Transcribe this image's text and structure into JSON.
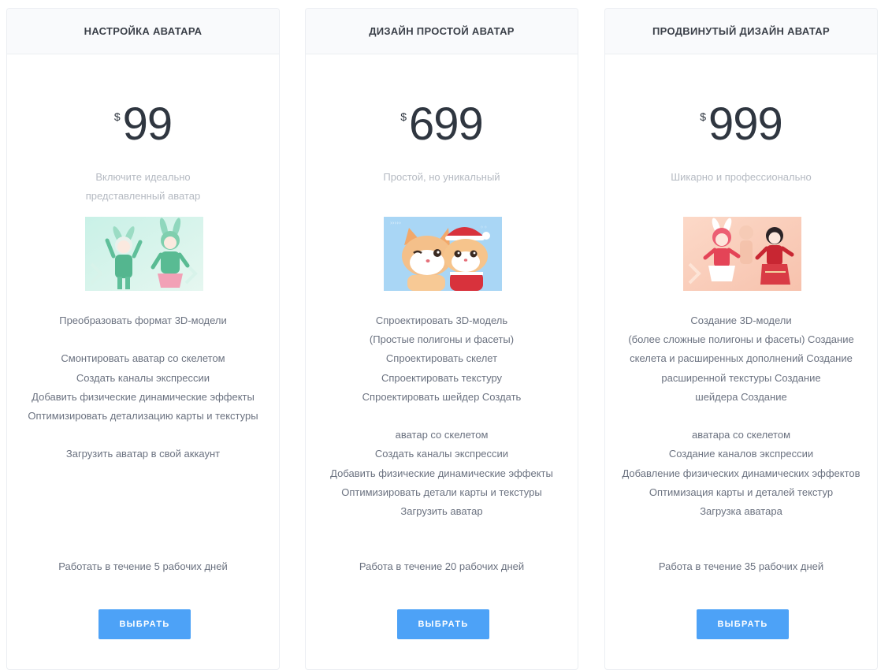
{
  "plans": [
    {
      "title": "НАСТРОЙКА АВАТАРА",
      "currency": "$",
      "price": "99",
      "subtitle": [
        "Включите идеально",
        "представленный аватар"
      ],
      "image": "avatar-anime-green-bunny-girls",
      "features": [
        "Преобразовать формат 3D-модели",
        "",
        "Смонтировать аватар со скелетом",
        "Создать каналы экспрессии",
        "Добавить физические динамические эффекты",
        "Оптимизировать детализацию карты и текстуры",
        "",
        "Загрузить аватар в свой аккаунт"
      ],
      "duration": "Работать в течение 5 рабочих дней",
      "button": "ВЫБРАТЬ"
    },
    {
      "title": "ДИЗАЙН ПРОСТОЙ АВАТАР",
      "currency": "$",
      "price": "699",
      "subtitle": [
        "Простой, но уникальный"
      ],
      "image": "avatar-cartoon-cats-santa",
      "features": [
        "Спроектировать 3D-модель",
        "(Простые полигоны и фасеты)",
        "Спроектировать скелет",
        "Спроектировать текстуру",
        "Спроектировать шейдер Создать",
        "",
        "аватар со скелетом",
        "Создать каналы экспрессии",
        "Добавить физические динамические эффекты",
        "Оптимизировать детали карты и текстуры",
        "Загрузить аватар"
      ],
      "duration": "Работа в течение 20 рабочих дней",
      "button": "ВЫБРАТЬ"
    },
    {
      "title": "ПРОДВИНУТЫЙ ДИЗАЙН АВАТАР",
      "currency": "$",
      "price": "999",
      "subtitle": [
        "Шикарно и профессионально"
      ],
      "image": "avatar-anime-red-dancers",
      "features": [
        "Создание 3D-модели",
        "(более сложные полигоны и фасеты) Создание",
        "скелета и расширенных дополнений Создание",
        "расширенной текстуры Создание",
        "шейдера Создание",
        "",
        "аватара со скелетом",
        "Создание каналов экспрессии",
        "Добавление физических динамических эффектов",
        "Оптимизация карты и деталей текстур",
        "Загрузка аватара"
      ],
      "duration": "Работа в течение 35 рабочих дней",
      "button": "ВЫБРАТЬ"
    }
  ],
  "colors": {
    "accent": "#4da2f7",
    "heading": "#3b4049",
    "price": "#2f3640",
    "muted": "#b5bac2",
    "body": "#6b7280",
    "header_bg": "#f9fafc",
    "border": "#ebeef2"
  }
}
